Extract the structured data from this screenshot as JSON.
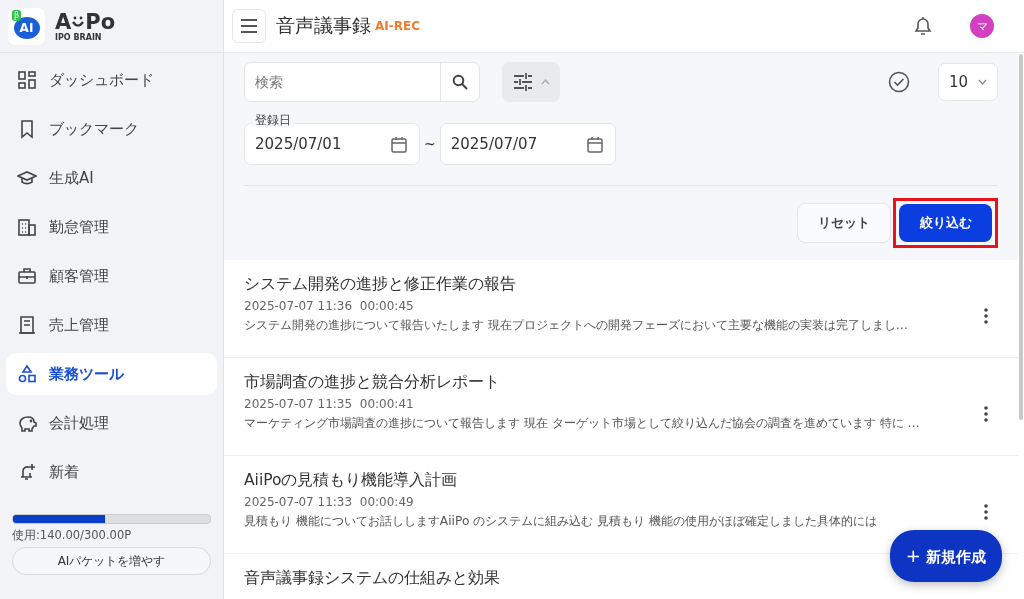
{
  "logo": {
    "badge": "β",
    "mark": "AI",
    "name_start": "A",
    "name_end": "Po",
    "tagline": "IPO BRAIN"
  },
  "sidebar": {
    "items": [
      {
        "label": "ダッシュボード",
        "selected": false
      },
      {
        "label": "ブックマーク",
        "selected": false
      },
      {
        "label": "生成AI",
        "selected": false
      },
      {
        "label": "勤怠管理",
        "selected": false
      },
      {
        "label": "顧客管理",
        "selected": false
      },
      {
        "label": "売上管理",
        "selected": false
      },
      {
        "label": "業務ツール",
        "selected": true
      },
      {
        "label": "会計処理",
        "selected": false
      },
      {
        "label": "新着",
        "selected": false
      }
    ],
    "usage": {
      "level": 0.467,
      "text": "使用:140.00/300.00P"
    },
    "add_button": "AIパケットを増やす"
  },
  "header": {
    "title": "音声議事録",
    "tag": "AI-REC",
    "avatar": "マ"
  },
  "filters": {
    "search": {
      "placeholder": "検索"
    },
    "filter_panel": {
      "expanded": true
    },
    "per_page": "10",
    "date_label": "登録日",
    "date_from": "2025/07/01",
    "separator": "~",
    "date_to": "2025/07/07",
    "reset_button": "リセット",
    "apply_button": {
      "label": "絞り込む",
      "highlighted": true
    }
  },
  "records": [
    {
      "title": "システム開発の進捗と修正作業の報告",
      "datetime": "2025-07-07 11:36",
      "duration": "00:00:45",
      "preview": "システム開発の進捗について報告いたします 現在プロジェクトへの開発フェーズにおいて主要な機能の実装は完了しまし…"
    },
    {
      "title": "市場調査の進捗と競合分析レポート",
      "datetime": "2025-07-07 11:35",
      "duration": "00:00:41",
      "preview": "マーケティング市場調査の進捗について報告します 現在 ターゲット市場として絞り込んだ協会の調査を進めています 特に …"
    },
    {
      "title": "AiiPoの見積もり機能導入計画",
      "datetime": "2025-07-07 11:33",
      "duration": "00:00:49",
      "preview": "見積もり 機能についてお話ししますAiiPo のシステムに組み込む 見積もり 機能の使用がほぼ確定しました具体的には"
    },
    {
      "title": "音声議事録システムの仕組みと効果"
    }
  ],
  "fab": {
    "plus": "+",
    "label": "新規作成"
  }
}
